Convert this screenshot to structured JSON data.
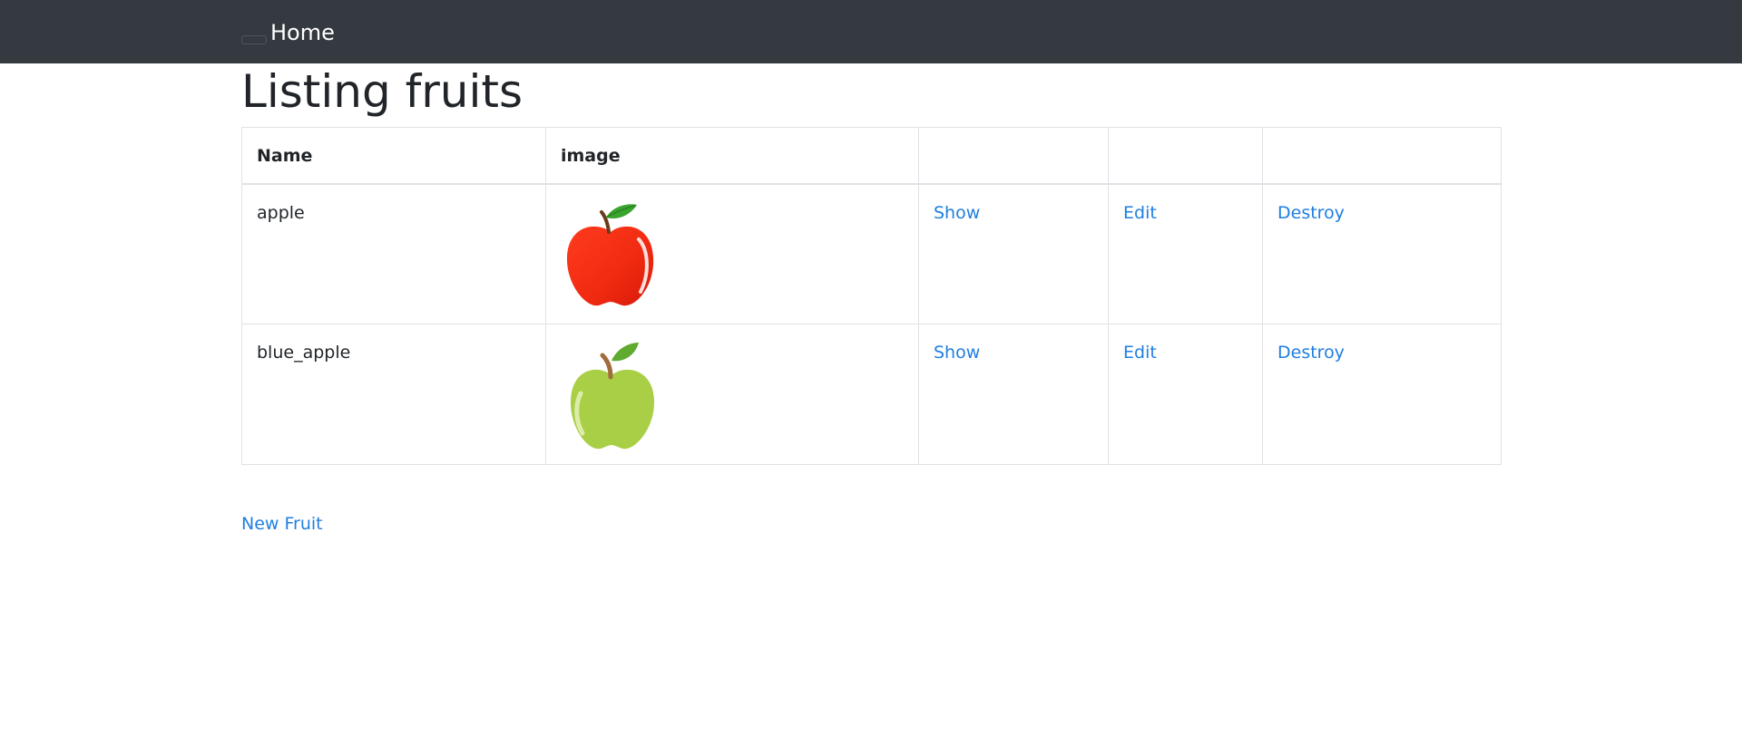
{
  "nav": {
    "brand": "Home"
  },
  "page": {
    "title": "Listing fruits"
  },
  "table": {
    "headers": [
      "Name",
      "image",
      "",
      "",
      ""
    ],
    "rows": [
      {
        "name": "apple",
        "image_icon": "red-apple-icon",
        "show": "Show",
        "edit": "Edit",
        "destroy": "Destroy"
      },
      {
        "name": "blue_apple",
        "image_icon": "green-apple-icon",
        "show": "Show",
        "edit": "Edit",
        "destroy": "Destroy"
      }
    ]
  },
  "actions": {
    "new_fruit": "New Fruit"
  },
  "colors": {
    "navbar": "#343a40",
    "link": "#1f7fe0",
    "border": "#dee2e6"
  }
}
